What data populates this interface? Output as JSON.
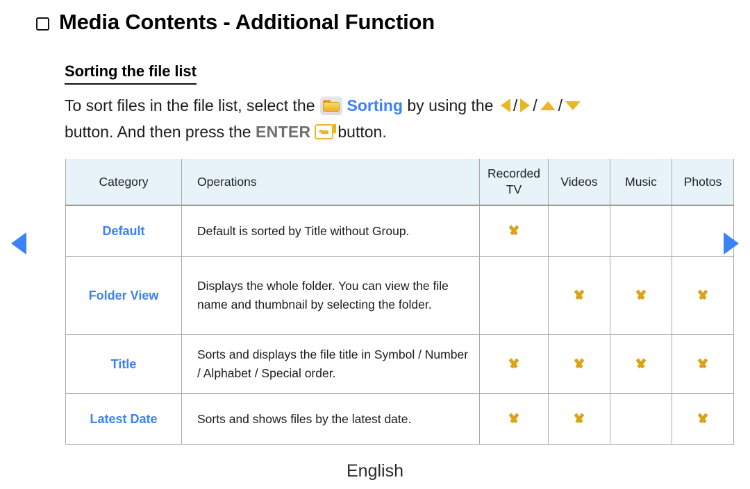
{
  "page": {
    "title": "Media Contents - Additional Function",
    "bullet_icon": "square-outline-icon",
    "section_heading": "Sorting the file list",
    "footer_language": "English"
  },
  "instructions": {
    "line1_part1": "To sort files in the file list, select the",
    "folder_icon": "folder-icon",
    "sorting_label": "Sorting",
    "line1_part2": "by using the",
    "arrow_left_icon": "triangle-left-icon",
    "arrow_right_icon": "triangle-right-icon",
    "arrow_up_icon": "triangle-up-icon",
    "arrow_down_icon": "triangle-down-icon",
    "separator": "/",
    "line2_part1": "button. And then press the",
    "enter_label": "ENTER",
    "enter_icon": "enter-key-icon",
    "line2_part2": "button."
  },
  "navigation": {
    "prev_icon": "triangle-left-icon",
    "next_icon": "triangle-right-icon"
  },
  "table": {
    "headers": {
      "category": "Category",
      "operations": "Operations",
      "recorded_tv_line1": "Recorded",
      "recorded_tv_line2": "TV",
      "videos": "Videos",
      "music": "Music",
      "photos": "Photos"
    },
    "rows": [
      {
        "category": "Default",
        "operations": "Default is sorted by Title without Group.",
        "recorded_tv": true,
        "videos": false,
        "music": false,
        "photos": false
      },
      {
        "category": "Folder View",
        "operations": "Displays the whole folder. You can view the file name and thumbnail by selecting the folder.",
        "recorded_tv": false,
        "videos": true,
        "music": true,
        "photos": true
      },
      {
        "category": "Title",
        "operations": "Sorts and displays the file title in Symbol / Number / Alphabet / Special order.",
        "recorded_tv": true,
        "videos": true,
        "music": true,
        "photos": true
      },
      {
        "category": "Latest Date",
        "operations": "Sorts and shows files by the latest date.",
        "recorded_tv": true,
        "videos": true,
        "music": false,
        "photos": true
      }
    ]
  },
  "colors": {
    "accent_blue": "#3b82f6",
    "gold": "#d9a417",
    "header_bg": "#e7f3f8",
    "border": "#a9a9a9",
    "enter_gray": "#6f6f6f"
  }
}
